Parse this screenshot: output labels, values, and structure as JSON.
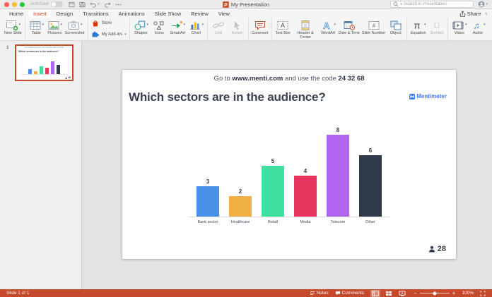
{
  "titlebar": {
    "autosave_label": "AutoSave",
    "quick_access_icons": [
      "window-icon",
      "save-icon",
      "undo-icon",
      "redo-icon",
      "more-icon"
    ],
    "document_title": "My Presentation",
    "search_placeholder": "Search in Presentation"
  },
  "ribbon": {
    "tabs": [
      {
        "label": "Home",
        "active": false
      },
      {
        "label": "Insert",
        "active": true
      },
      {
        "label": "Design",
        "active": false
      },
      {
        "label": "Transitions",
        "active": false
      },
      {
        "label": "Animations",
        "active": false
      },
      {
        "label": "Slide Show",
        "active": false
      },
      {
        "label": "Review",
        "active": false
      },
      {
        "label": "View",
        "active": false
      }
    ],
    "share_label": "Share",
    "groups": [
      {
        "type": "normal",
        "buttons": [
          {
            "label": "New Slide",
            "icon": "new-slide-icon",
            "caret": true
          }
        ]
      },
      {
        "type": "normal",
        "buttons": [
          {
            "label": "Table",
            "icon": "table-icon",
            "caret": true
          },
          {
            "label": "Pictures",
            "icon": "pictures-icon",
            "caret": true
          },
          {
            "label": "Screenshot",
            "icon": "screenshot-icon",
            "caret": true
          }
        ]
      },
      {
        "type": "stacked",
        "buttons": [
          {
            "label": "Store",
            "icon": "store-icon"
          },
          {
            "label": "My Add-ins",
            "icon": "add-ins-icon",
            "caret": true
          }
        ]
      },
      {
        "type": "normal",
        "buttons": [
          {
            "label": "Shapes",
            "icon": "shapes-icon",
            "caret": true
          },
          {
            "label": "Icons",
            "icon": "icons-icon"
          },
          {
            "label": "SmartArt",
            "icon": "smartart-icon",
            "caret": true
          },
          {
            "label": "Chart",
            "icon": "chart-icon",
            "caret": true
          }
        ]
      },
      {
        "type": "normal",
        "buttons": [
          {
            "label": "Link",
            "icon": "link-icon",
            "disabled": true
          },
          {
            "label": "Action",
            "icon": "action-icon",
            "disabled": true
          }
        ]
      },
      {
        "type": "normal",
        "buttons": [
          {
            "label": "Comment",
            "icon": "comment-icon"
          }
        ]
      },
      {
        "type": "normal",
        "buttons": [
          {
            "label": "Text Box",
            "icon": "text-box-icon"
          },
          {
            "label": "Header & Footer",
            "icon": "header-footer-icon"
          },
          {
            "label": "WordArt",
            "icon": "wordart-icon",
            "caret": true
          },
          {
            "label": "Date & Time",
            "icon": "date-time-icon"
          },
          {
            "label": "Slide Number",
            "icon": "slide-number-icon"
          },
          {
            "label": "Object",
            "icon": "object-icon"
          }
        ]
      },
      {
        "type": "normal",
        "buttons": [
          {
            "label": "Equation",
            "icon": "equation-icon",
            "caret": true
          },
          {
            "label": "Symbol",
            "icon": "symbol-icon",
            "disabled": true
          }
        ]
      },
      {
        "type": "normal",
        "buttons": [
          {
            "label": "Video",
            "icon": "video-icon",
            "caret": true
          },
          {
            "label": "Audio",
            "icon": "audio-icon",
            "caret": true
          }
        ]
      }
    ]
  },
  "slide_panel": {
    "slide_number": "1"
  },
  "slide": {
    "banner_prefix": "Go to ",
    "banner_url": "www.menti.com",
    "banner_middle": " and use the code ",
    "banner_code": "24 32 68",
    "brand": "Mentimeter",
    "respondents": "28"
  },
  "chart_data": {
    "type": "bar",
    "title": "Which sectors are in the audience?",
    "categories": [
      "Bank sector",
      "Healthcare",
      "Retail",
      "Media",
      "Telecom",
      "Other"
    ],
    "values": [
      3,
      2,
      5,
      4,
      8,
      6
    ],
    "bar_colors": [
      "#4a90e8",
      "#f0b144",
      "#3fe0a0",
      "#e8355f",
      "#b164ef",
      "#2f3b4d"
    ],
    "ylim": [
      0,
      8
    ],
    "value_labels_shown": true,
    "grid": false,
    "legend": false
  },
  "statusbar": {
    "slide_indicator": "Slide 1 of 1",
    "notes_label": "Notes",
    "comments_label": "Comments",
    "view_icons": [
      "normal-view-icon",
      "slide-sorter-icon",
      "slideshow-icon"
    ],
    "zoom_level": "100%"
  }
}
